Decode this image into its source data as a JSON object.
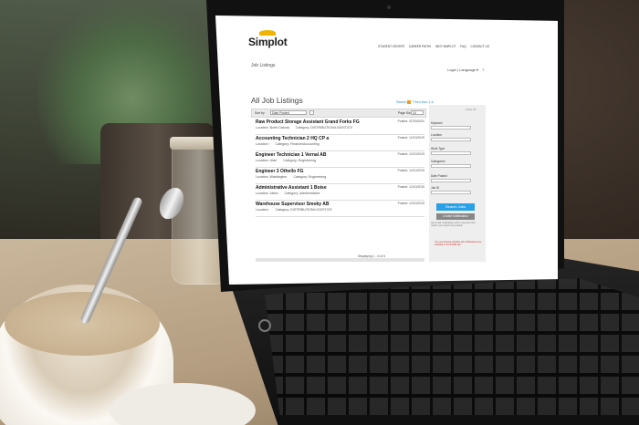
{
  "site": {
    "logo_text": "Simplot",
    "nav": [
      "STUDENT CENTER",
      "CAREER PATHS",
      "WHY SIMPLOT",
      "FAQ",
      "CONTACT US"
    ],
    "breadcrumb": "Job Listings",
    "login": "Login",
    "language": "Language",
    "login_sep": "|",
    "language_caret": "▾",
    "help_glyph": "?"
  },
  "listings": {
    "page_title": "All Job Listings",
    "rss_label": "Search",
    "rss_count": "Feed Icon",
    "rss_jobs": "1-6",
    "sort_label": "Sort by",
    "sort_value": "Date Posted",
    "page_size_label": "Page Size",
    "page_size_value": "10",
    "jobs": [
      {
        "title": "Raw Product Storage Assistant Grand Forks FG",
        "location": "Location: North Dakota",
        "category": "Category: DISTRIBUTION/LOGISTICS",
        "posted": "Posted: 01/03/2020"
      },
      {
        "title": "Accounting Technician 2 HQ CP a",
        "location": "Location:",
        "category": "Category: Finance/Accounting",
        "posted": "Posted: 12/13/2019"
      },
      {
        "title": "Engineer Technician 1 Vernal AB",
        "location": "Location: Utah",
        "category": "Category: Engineering",
        "posted": "Posted: 12/10/2019"
      },
      {
        "title": "Engineer 3 Othello FG",
        "location": "Location: Washington",
        "category": "Category: Engineering",
        "posted": "Posted: 12/10/2019"
      },
      {
        "title": "Administrative Assistant 1 Boise",
        "location": "Location: Idaho",
        "category": "Category: Administrative",
        "posted": "Posted: 12/10/2019"
      },
      {
        "title": "Warehouse Supervisor Smoky AB",
        "location": "Location:",
        "category": "Category: DISTRIBUTION/LOGISTICS",
        "posted": "Posted: 12/10/2019"
      }
    ],
    "pager": "Displaying 1 - 6 of 6"
  },
  "sidebar": {
    "header": "Clear All",
    "fields": [
      {
        "label": "Keyword"
      },
      {
        "label": "Location"
      },
      {
        "label": "Work Type"
      },
      {
        "label": "Categories"
      },
      {
        "label": "Date Posted"
      },
      {
        "label": "Job ID"
      }
    ],
    "search_button": "Search Jobs",
    "create_button": "Create Notification",
    "note": "Get email notifications when new jobs that match your search are posted.",
    "warning": "You can choose whether job notifications are enabled in the Profile tab."
  },
  "colors": {
    "accent_blue": "#2aa0e6",
    "logo_yellow": "#f0b400",
    "warning_red": "#c0392b"
  }
}
